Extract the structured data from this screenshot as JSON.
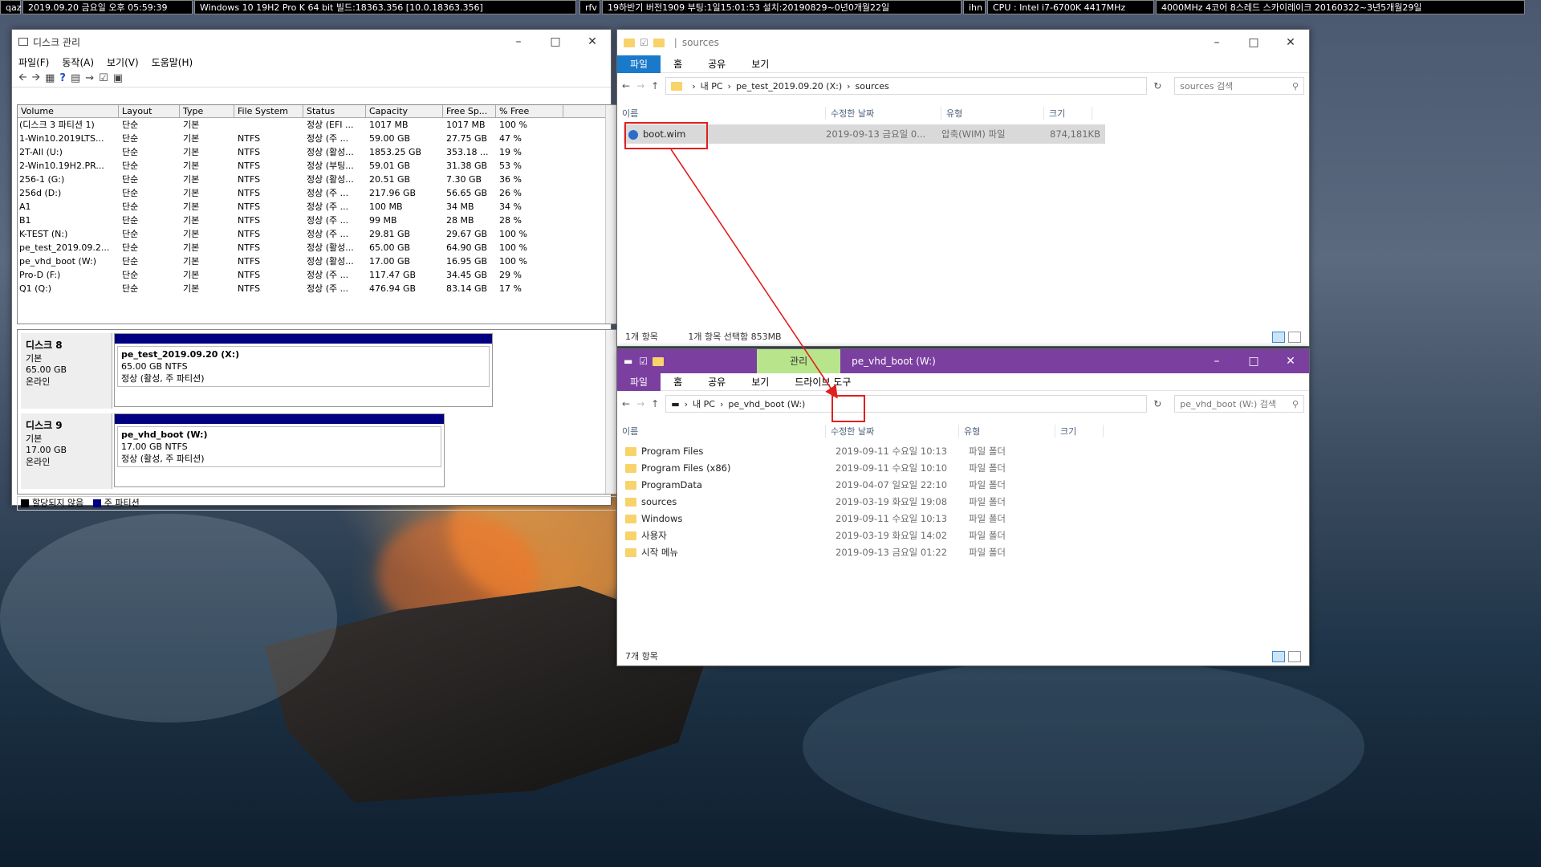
{
  "topbar": [
    "qaz",
    "2019.09.20 금요일 오후 05:59:39",
    "Windows 10 19H2 Pro K 64 bit 빌드:18363.356 [10.0.18363.356]",
    "rfv",
    "19하반기 버전1909 부팅:1일15:01:53 설치:20190829~0년0개월22일",
    "ihn",
    "CPU : Intel i7-6700K 4417MHz",
    "4000MHz 4코어 8스레드 스카이레이크 20160322~3년5개월29일"
  ],
  "disk_mgmt": {
    "title": "디스크 관리",
    "menu": [
      "파일(F)",
      "동작(A)",
      "보기(V)",
      "도움말(H)"
    ],
    "columns": [
      "Volume",
      "Layout",
      "Type",
      "File System",
      "Status",
      "Capacity",
      "Free Sp...",
      "% Free"
    ],
    "rows": [
      [
        "(디스크 3 파티션 1)",
        "단순",
        "기본",
        "",
        "정상 (EFI ...",
        "1017 MB",
        "1017 MB",
        "100 %"
      ],
      [
        "1-Win10.2019LTS...",
        "단순",
        "기본",
        "NTFS",
        "정상 (주 ...",
        "59.00 GB",
        "27.75 GB",
        "47 %"
      ],
      [
        "2T-All (U:)",
        "단순",
        "기본",
        "NTFS",
        "정상 (활성...",
        "1853.25 GB",
        "353.18 ...",
        "19 %"
      ],
      [
        "2-Win10.19H2.PR...",
        "단순",
        "기본",
        "NTFS",
        "정상 (부팅...",
        "59.01 GB",
        "31.38 GB",
        "53 %"
      ],
      [
        "256-1 (G:)",
        "단순",
        "기본",
        "NTFS",
        "정상 (활성...",
        "20.51 GB",
        "7.30 GB",
        "36 %"
      ],
      [
        "256d (D:)",
        "단순",
        "기본",
        "NTFS",
        "정상 (주 ...",
        "217.96 GB",
        "56.65 GB",
        "26 %"
      ],
      [
        "A1",
        "단순",
        "기본",
        "NTFS",
        "정상 (주 ...",
        "100 MB",
        "34 MB",
        "34 %"
      ],
      [
        "B1",
        "단순",
        "기본",
        "NTFS",
        "정상 (주 ...",
        "99 MB",
        "28 MB",
        "28 %"
      ],
      [
        "K-TEST (N:)",
        "단순",
        "기본",
        "NTFS",
        "정상 (주 ...",
        "29.81 GB",
        "29.67 GB",
        "100 %"
      ],
      [
        "pe_test_2019.09.2...",
        "단순",
        "기본",
        "NTFS",
        "정상 (활성...",
        "65.00 GB",
        "64.90 GB",
        "100 %"
      ],
      [
        "pe_vhd_boot (W:)",
        "단순",
        "기본",
        "NTFS",
        "정상 (활성...",
        "17.00 GB",
        "16.95 GB",
        "100 %"
      ],
      [
        "Pro-D (F:)",
        "단순",
        "기본",
        "NTFS",
        "정상 (주 ...",
        "117.47 GB",
        "34.45 GB",
        "29 %"
      ],
      [
        "Q1 (Q:)",
        "단순",
        "기본",
        "NTFS",
        "정상 (주 ...",
        "476.94 GB",
        "83.14 GB",
        "17 %"
      ]
    ],
    "disk8": {
      "name": "디스크 8",
      "type": "기본",
      "size": "65.00 GB",
      "state": "온라인",
      "part_name": "pe_test_2019.09.20  (X:)",
      "part_size": "65.00 GB NTFS",
      "part_status": "정상 (활성, 주 파티션)"
    },
    "disk9": {
      "name": "디스크 9",
      "type": "기본",
      "size": "17.00 GB",
      "state": "온라인",
      "part_name": "pe_vhd_boot  (W:)",
      "part_size": "17.00 GB NTFS",
      "part_status": "정상 (활성, 주 파티션)"
    },
    "legend_unalloc": "할당되지 않음",
    "legend_primary": "주 파티션"
  },
  "explorer1": {
    "title": "sources",
    "ribbon": [
      "파일",
      "홈",
      "공유",
      "보기"
    ],
    "path": [
      "내 PC",
      "pe_test_2019.09.20 (X:)",
      "sources"
    ],
    "search": "sources 검색",
    "cols": [
      "이름",
      "수정한 날짜",
      "유형",
      "크기"
    ],
    "files": [
      {
        "name": "boot.wim",
        "date": "2019-09-13 금요일 0...",
        "type": "압축(WIM) 파일",
        "size": "874,181KB"
      }
    ],
    "status_count": "1개 항목",
    "status_sel": "1개 항목 선택함 853MB"
  },
  "explorer2": {
    "title": "pe_vhd_boot (W:)",
    "manage_tab": "관리",
    "ribbon": [
      "파일",
      "홈",
      "공유",
      "보기",
      "드라이브 도구"
    ],
    "path": [
      "내 PC",
      "pe_vhd_boot (W:)"
    ],
    "search": "pe_vhd_boot (W:) 검색",
    "cols": [
      "이름",
      "수정한 날짜",
      "유형",
      "크기"
    ],
    "files": [
      {
        "name": "Program Files",
        "date": "2019-09-11 수요일 10:13",
        "type": "파일 폴더"
      },
      {
        "name": "Program Files (x86)",
        "date": "2019-09-11 수요일 10:10",
        "type": "파일 폴더"
      },
      {
        "name": "ProgramData",
        "date": "2019-04-07 일요일 22:10",
        "type": "파일 폴더"
      },
      {
        "name": "sources",
        "date": "2019-03-19 화요일 19:08",
        "type": "파일 폴더"
      },
      {
        "name": "Windows",
        "date": "2019-09-11 수요일 10:13",
        "type": "파일 폴더"
      },
      {
        "name": "사용자",
        "date": "2019-03-19 화요일 14:02",
        "type": "파일 폴더"
      },
      {
        "name": "시작 메뉴",
        "date": "2019-09-13 금요일 01:22",
        "type": "파일 폴더"
      }
    ],
    "status_count": "7개 항목"
  },
  "colors": {
    "accent": "#1979ca",
    "purple": "#7b3fa0",
    "green": "#b8e58c",
    "highlight": "#e02020"
  }
}
